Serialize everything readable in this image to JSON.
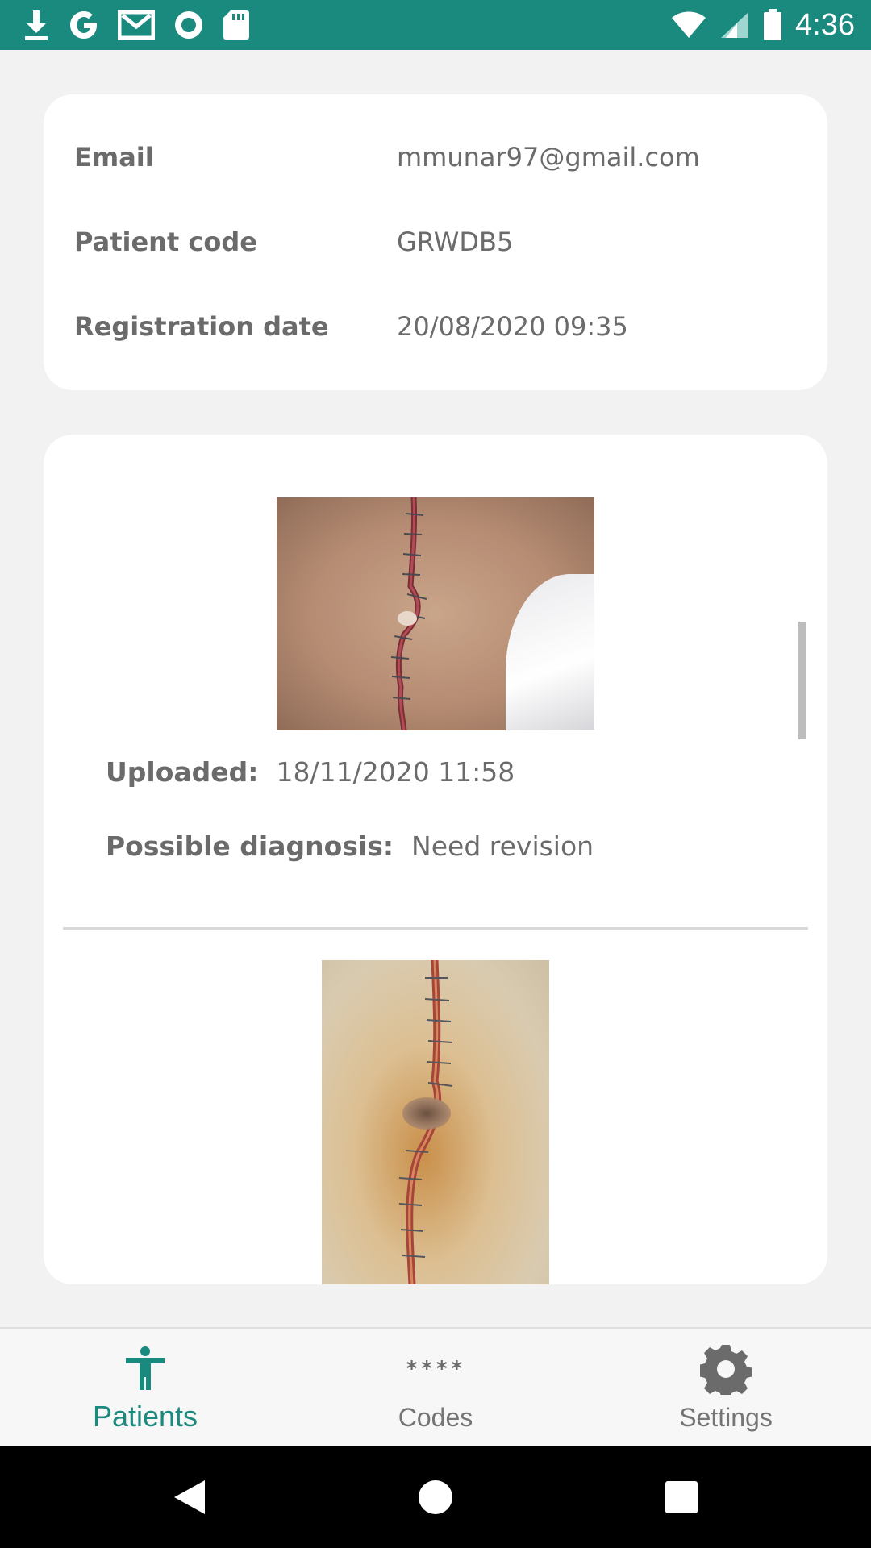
{
  "status_bar": {
    "time": "4:36",
    "icons_left": [
      "download-icon",
      "google-icon",
      "gmail-icon",
      "record-icon",
      "sd-card-icon"
    ],
    "icons_right": [
      "wifi-icon",
      "signal-icon",
      "battery-icon"
    ]
  },
  "patient_info": {
    "rows": [
      {
        "label": "Email",
        "value": "mmunar97@gmail.com"
      },
      {
        "label": "Patient code",
        "value": "GRWDB5"
      },
      {
        "label": "Registration date",
        "value": "20/08/2020 09:35"
      }
    ]
  },
  "uploads": [
    {
      "uploaded_label": "Uploaded:",
      "uploaded_value": "18/11/2020 11:58",
      "diagnosis_label": "Possible diagnosis:",
      "diagnosis_value": "Need revision"
    }
  ],
  "bottom_nav": {
    "items": [
      {
        "label": "Patients",
        "icon": "accessibility-icon",
        "active": true
      },
      {
        "label": "Codes",
        "icon": "asterisks-icon",
        "icon_text": "****",
        "active": false
      },
      {
        "label": "Settings",
        "icon": "gear-icon",
        "active": false
      }
    ]
  },
  "system_nav": [
    "back-icon",
    "home-icon",
    "recents-icon"
  ],
  "colors": {
    "accent": "#1a8a7f",
    "background": "#f2f2f2",
    "card": "#ffffff",
    "text": "#6b6b6b"
  }
}
